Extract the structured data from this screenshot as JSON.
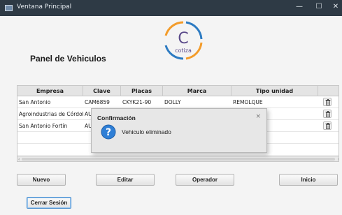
{
  "window": {
    "title": "Ventana Principal",
    "minimize_glyph": "—",
    "maximize_glyph": "☐",
    "close_glyph": "✕"
  },
  "logo": {
    "text": "cotiza"
  },
  "panel": {
    "title": "Panel de Vehiculos"
  },
  "table": {
    "columns": [
      "Empresa",
      "Clave",
      "Placas",
      "Marca",
      "Tipo unidad",
      ""
    ],
    "rows": [
      {
        "empresa": "San Antonio",
        "clave": "CAM6859",
        "placas": "CKYK21-90",
        "marca": "DOLLY",
        "tipo": "REMOLQUE"
      },
      {
        "empresa": "Agroindustrias de Córdoba",
        "clave": "AUT",
        "placas": "",
        "marca": "",
        "tipo": ""
      },
      {
        "empresa": "San Antonio Fortín",
        "clave": "AUT-",
        "placas": "",
        "marca": "",
        "tipo": ""
      }
    ]
  },
  "dialog": {
    "title": "Confirmación",
    "close_glyph": "×",
    "message": "Vehiculo eliminado"
  },
  "buttons": {
    "nuevo": "Nuevo",
    "editar": "Editar",
    "operador": "Operador",
    "inicio": "Inicio",
    "cerrar_sesion": "Cerrar Sesión"
  },
  "icons": {
    "app": "window-icon",
    "delete": "trash-icon",
    "info": "info-icon"
  },
  "colors": {
    "titlebar": "#2e3a45",
    "logo_orange": "#f39c2b",
    "logo_blue": "#2d7bc2",
    "logo_text": "#5a4a8a",
    "info_blue": "#2f7fd6"
  }
}
